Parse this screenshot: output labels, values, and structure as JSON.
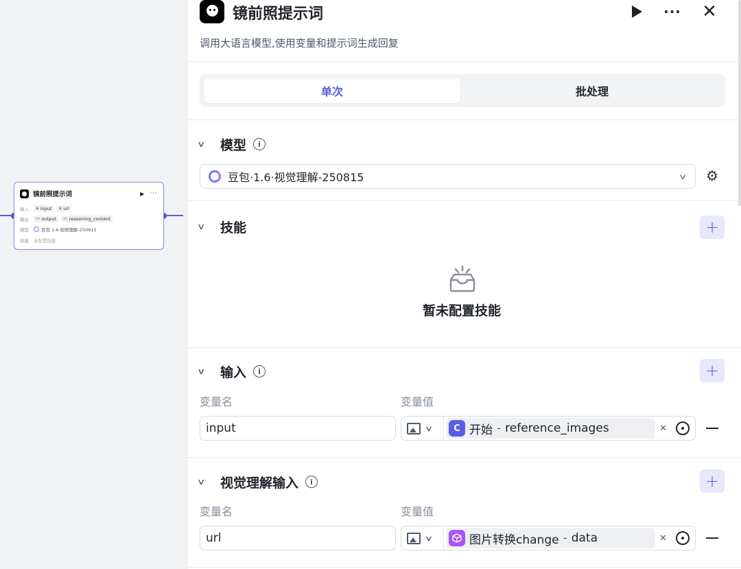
{
  "node": {
    "title": "镜前照提示词",
    "run_glyph": "▶",
    "more_glyph": "···",
    "rows": {
      "input_label": "输入",
      "input_vars": [
        "input",
        "url"
      ],
      "output_label": "输出",
      "output_var1": "output",
      "output_var1_type": "str",
      "output_var2": "reasoning_content",
      "output_var2_type": "str",
      "model_label": "模型",
      "model_value": "豆包·1.6·视觉理解-250815",
      "skill_label": "技能",
      "skill_value": "未配置技能"
    }
  },
  "header": {
    "title": "镜前照提示词",
    "description": "调用大语言模型,使用变量和提示词生成回复",
    "more_glyph": "···",
    "close_glyph": "✕"
  },
  "tabs": [
    {
      "label": "单次",
      "active": true
    },
    {
      "label": "批处理",
      "active": false
    }
  ],
  "model_section": {
    "title": "模型",
    "info_glyph": "i",
    "selected_model": "豆包·1.6·视觉理解-250815",
    "settings_glyph": "⚙"
  },
  "skills_section": {
    "title": "技能",
    "add_glyph": "+",
    "empty_text": "暂未配置技能"
  },
  "input_section": {
    "title": "输入",
    "info_glyph": "i",
    "add_glyph": "+",
    "col_name": "变量名",
    "col_value": "变量值",
    "rows": [
      {
        "name": "input",
        "type_icon": "image-icon",
        "source": "开始",
        "source_icon": "C",
        "variable": "reference_images"
      }
    ]
  },
  "vision_section": {
    "title": "视觉理解输入",
    "info_glyph": "i",
    "add_glyph": "+",
    "col_name": "变量名",
    "col_value": "变量值",
    "rows": [
      {
        "name": "url",
        "type_icon": "image-icon",
        "source": "图片转换change",
        "source_icon": "cube",
        "variable": "data"
      }
    ]
  },
  "common": {
    "dash": "-",
    "clear_glyph": "✕",
    "chevron_glyph": "⌄",
    "row_chevron": "∨"
  },
  "colors": {
    "accent": "#5b5ce6",
    "accent_bg": "#e8e8fb",
    "source_blue": "#5b5ce6",
    "source_purple": "#a855f7"
  }
}
